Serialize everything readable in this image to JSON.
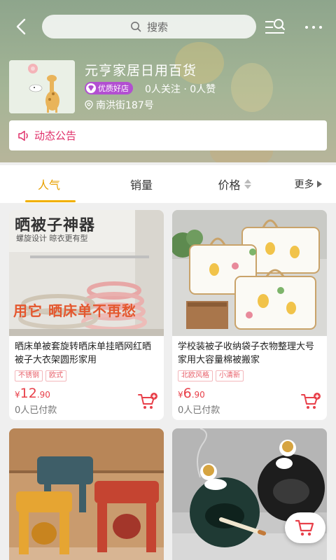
{
  "header": {
    "search_placeholder": "搜索"
  },
  "store": {
    "name": "元亨家居日用百货",
    "badge": "优质好店",
    "stats": "0人关注 · 0人赞",
    "address": "南洪街187号"
  },
  "notice": {
    "label": "动态公告"
  },
  "tabs": {
    "popular": "人气",
    "sales": "销量",
    "price": "价格",
    "more": "更多"
  },
  "products": [
    {
      "title": "晒床单被套旋转晒床单挂晒网红晒被子大衣架圆形家用",
      "tags": [
        "不锈钢",
        "欧式"
      ],
      "currency": "¥",
      "price_int": "12",
      "price_dec": ".90",
      "sold": "0人已付款",
      "overlay_title": "晒被子神器",
      "overlay_sub": "螺旋设计 晾衣更有型",
      "overlay_red": "用它 晒床单不再愁"
    },
    {
      "title": "学校装被子收纳袋子衣物整理大号家用大容量棉被搬家",
      "tags": [
        "北欧风格",
        "小清新"
      ],
      "currency": "¥",
      "price_int": "6",
      "price_dec": ".90",
      "sold": "0人已付款"
    }
  ],
  "colors": {
    "accent": "#f1b000",
    "price": "#e8404a",
    "notice": "#e0306a",
    "badge": "#b24fd1"
  }
}
